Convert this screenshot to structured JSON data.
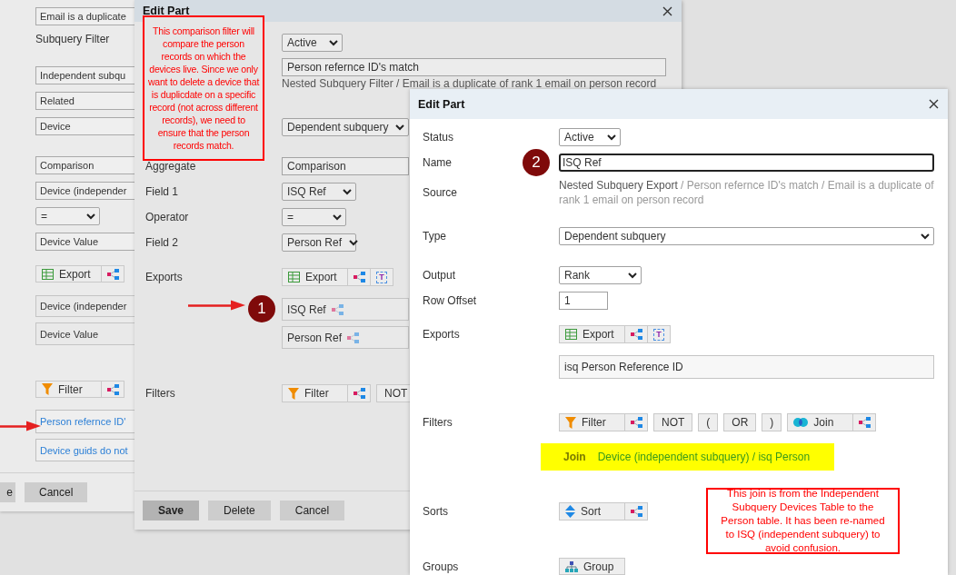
{
  "back_panel": {
    "rows": [
      {
        "kind": "field",
        "value": "Email is a duplicate"
      },
      {
        "kind": "label",
        "text": "Subquery Filter"
      },
      {
        "kind": "field",
        "value": "Independent subqu"
      },
      {
        "kind": "field",
        "value": "Related"
      },
      {
        "kind": "field",
        "value": "Device"
      },
      {
        "kind": "field",
        "value": "Comparison"
      },
      {
        "kind": "field",
        "value": "Device (independer"
      },
      {
        "kind": "select",
        "value": "="
      },
      {
        "kind": "field",
        "value": "Device Value"
      },
      {
        "kind": "toolbar",
        "buttons": [
          {
            "kind": "export",
            "label": "Export"
          },
          {
            "kind": "share"
          }
        ]
      },
      {
        "kind": "item",
        "value": "Device (independer"
      },
      {
        "kind": "item",
        "value": "Device Value"
      },
      {
        "kind": "toolbar",
        "buttons": [
          {
            "kind": "filter",
            "label": "Filter"
          },
          {
            "kind": "share"
          }
        ]
      },
      {
        "kind": "link",
        "value": "Person refernce ID'"
      },
      {
        "kind": "link",
        "value": "Device guids do not"
      }
    ],
    "buttons": [
      {
        "label": "e",
        "primary": false
      },
      {
        "label": "Cancel",
        "primary": false
      }
    ]
  },
  "middle_dialog": {
    "title": "Edit Part",
    "note": "This comparison filter will compare the person records on which the devices live. Since we only want to delete a device that is duplicdate on a specific record (not across different records), we need to ensure that the person records match.",
    "badge": "1",
    "rows": [
      {
        "kind": "select",
        "value": "Active"
      },
      {
        "kind": "input",
        "value": "Person refernce ID's match",
        "focused": false
      },
      {
        "kind": "text",
        "value": "Nested Subquery Filter / Email is a duplicate of rank 1 email on person record"
      },
      {
        "kind": "select",
        "value": "Dependent subquery"
      },
      {
        "label": "Aggregate",
        "kind": "field",
        "value": "Comparison"
      },
      {
        "label": "Field 1",
        "kind": "select",
        "value": "ISQ Ref"
      },
      {
        "label": "Operator",
        "kind": "select",
        "value": "="
      },
      {
        "label": "Field 2",
        "kind": "select",
        "value": "Person Ref"
      },
      {
        "label": "Exports",
        "kind": "toolbar",
        "buttons": [
          {
            "kind": "export",
            "label": "Export"
          },
          {
            "kind": "share"
          },
          {
            "kind": "text",
            "label": "T"
          }
        ]
      },
      {
        "kind": "export_item",
        "value": "ISQ Ref"
      },
      {
        "kind": "export_item",
        "value": "Person Ref"
      },
      {
        "label": "Filters",
        "kind": "toolbar",
        "buttons": [
          {
            "kind": "filter",
            "label": "Filter"
          },
          {
            "kind": "share"
          },
          {
            "kind": "op",
            "label": "NOT"
          }
        ]
      }
    ],
    "buttons": [
      {
        "label": "Save",
        "primary": true
      },
      {
        "label": "Delete",
        "primary": false
      },
      {
        "label": "Cancel",
        "primary": false
      }
    ]
  },
  "front_dialog": {
    "title": "Edit Part",
    "note": "This join is from the Independent Subquery Devices Table to the Person table. It has been re-named to ISQ (independent subquery) to avoid confusion.",
    "badge": "2",
    "rows": [
      {
        "label": "Status",
        "kind": "select",
        "value": "Active"
      },
      {
        "label": "Name",
        "kind": "input",
        "value": "ISQ Ref",
        "focused": true
      },
      {
        "label": "Source",
        "kind": "source",
        "current": "Nested Subquery Export",
        "path": "/ Person refernce ID's match / Email is a duplicate of rank 1 email on person record"
      },
      {
        "label": "Type",
        "kind": "select",
        "value": "Dependent subquery"
      },
      {
        "label": "Output",
        "kind": "select",
        "value": "Rank"
      },
      {
        "label": "Row Offset",
        "kind": "input",
        "value": "1",
        "focused": false
      },
      {
        "label": "Exports",
        "kind": "toolbar",
        "buttons": [
          {
            "kind": "export",
            "label": "Export"
          },
          {
            "kind": "share"
          },
          {
            "kind": "text",
            "label": "T"
          }
        ]
      },
      {
        "kind": "item",
        "value": "isq Person Reference ID"
      },
      {
        "label": "Filters",
        "kind": "toolbar",
        "buttons": [
          {
            "kind": "filter",
            "label": "Filter"
          },
          {
            "kind": "share"
          },
          {
            "kind": "op",
            "label": "NOT"
          },
          {
            "kind": "op",
            "label": "("
          },
          {
            "kind": "op",
            "label": "OR"
          },
          {
            "kind": "op",
            "label": ")"
          },
          {
            "kind": "join",
            "label": "Join"
          },
          {
            "kind": "share"
          }
        ]
      },
      {
        "kind": "highlight",
        "title": "Join",
        "value": "Device (independent subquery) / isq Person"
      },
      {
        "label": "Sorts",
        "kind": "toolbar",
        "buttons": [
          {
            "kind": "sort",
            "label": "Sort"
          },
          {
            "kind": "share"
          }
        ]
      },
      {
        "label": "Groups",
        "kind": "toolbar",
        "buttons": [
          {
            "kind": "group",
            "label": "Group"
          }
        ]
      }
    ]
  }
}
